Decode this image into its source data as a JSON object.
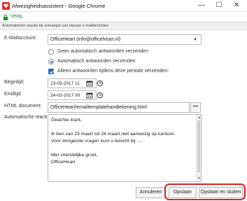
{
  "window": {
    "title": "Afwezigheidsassistent - Google Chrome",
    "minimize": "—",
    "maximize": "☐",
    "close": "✕"
  },
  "address": {
    "secure_label": "Veilig"
  },
  "banner": {
    "text": "Automatische reactie bij ontvangst van nieuwe e-mailberichten"
  },
  "form": {
    "email_label": "E-Mailaccount:",
    "email_value": "OfficeHeart (info@officeheart.nl)",
    "radio_off_label": "Geen automatisch antwoorden verzenden",
    "radio_on_label": "Automatisch antwoorden verzenden",
    "checkbox_label": "Alleen antwoorden tijdens deze periode verzenden:",
    "start_label": "Begintijd:",
    "start_value": "23-03-2017 11",
    "end_label": "Eindtijd:",
    "end_value": "24-03-2017 00",
    "doc_label": "HTML document:",
    "doc_value": "OfficeHeart/emailtemplatehandtekening.html",
    "doc_more": "•••",
    "reply_label": "Automatische reacti",
    "reply_lines": [
      "Geachte klant,",
      "",
      "Ik ben van 23 maart tot 24 maart niet aanwezig op kantoor.",
      "Voor dringende vragen kunt u terecht bij .....",
      "",
      "Met vriendelijke groet,",
      "OfficeHeart"
    ]
  },
  "buttons": {
    "cancel": "Annuleren",
    "save": "Opslaan",
    "save_close": "Opslaan en sluiten"
  },
  "colors": {
    "accent": "#2b6cc4",
    "highlight": "#e02020",
    "secure": "#1e8e3e"
  }
}
